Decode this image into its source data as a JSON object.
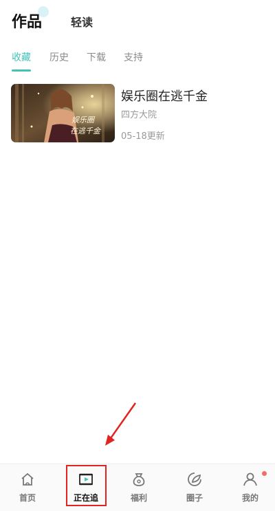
{
  "top_tabs": {
    "main": "作品",
    "secondary": "轻读"
  },
  "sub_tabs": [
    {
      "label": "收藏",
      "active": true
    },
    {
      "label": "历史",
      "active": false
    },
    {
      "label": "下载",
      "active": false
    },
    {
      "label": "支持",
      "active": false
    }
  ],
  "books": [
    {
      "title": "娱乐圈在逃千金",
      "author": "四方大院",
      "update": "05-18更新",
      "cover_text": [
        "娱乐圈",
        "在逃千金"
      ]
    }
  ],
  "bottom_nav": [
    {
      "label": "首页",
      "icon": "home-icon",
      "active": false
    },
    {
      "label": "正在追",
      "icon": "video-frame-icon",
      "active": true
    },
    {
      "label": "福利",
      "icon": "gift-pouch-icon",
      "active": false
    },
    {
      "label": "圈子",
      "icon": "circle-leaf-icon",
      "active": false
    },
    {
      "label": "我的",
      "icon": "user-icon",
      "active": false,
      "badge": true
    }
  ],
  "colors": {
    "accent": "#43c3b8",
    "highlight": "#e32222",
    "badge": "#f36b6b"
  }
}
